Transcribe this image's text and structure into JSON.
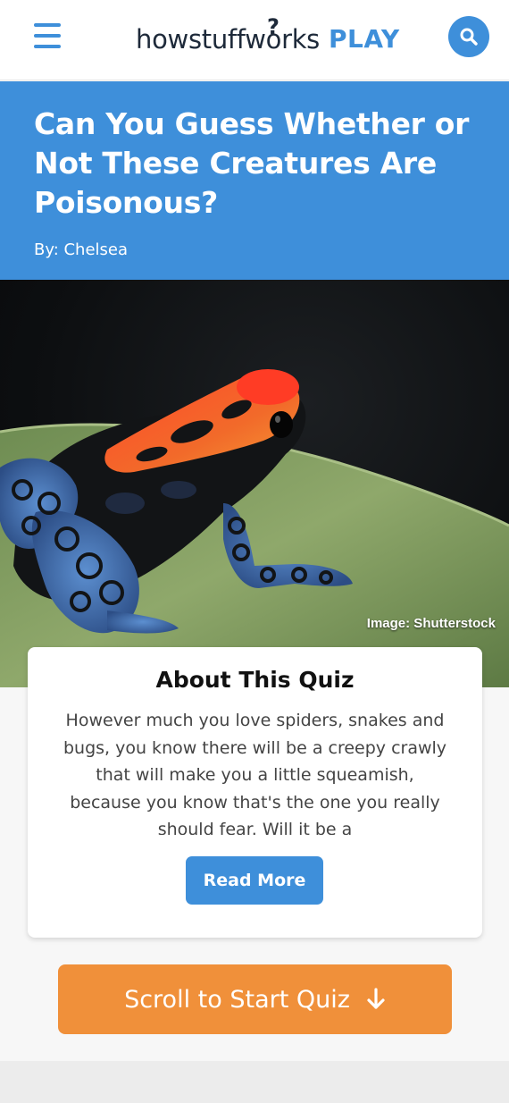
{
  "header": {
    "logo_main": "howstuffworks",
    "logo_q": "?",
    "logo_play": "PLAY",
    "menu_icon": "hamburger-icon",
    "search_icon": "search-icon"
  },
  "article": {
    "title": "Can You Guess Whether or Not These Creatures Are Poisonous?",
    "author": "By: Chelsea"
  },
  "hero": {
    "credit": "Image: Shutterstock"
  },
  "about": {
    "heading": "About This Quiz",
    "text": "However much you love spiders, snakes and bugs, you know there will be a creepy crawly that will make you a little squeamish, because you know that's the one you really should fear. Will it be a",
    "read_more": "Read More"
  },
  "cta": {
    "label": "Scroll to Start Quiz",
    "icon": "arrow-down-icon"
  },
  "colors": {
    "brand_blue": "#3e8fda",
    "cta_orange": "#f0903a",
    "logo_dark": "#1e2a3a"
  }
}
